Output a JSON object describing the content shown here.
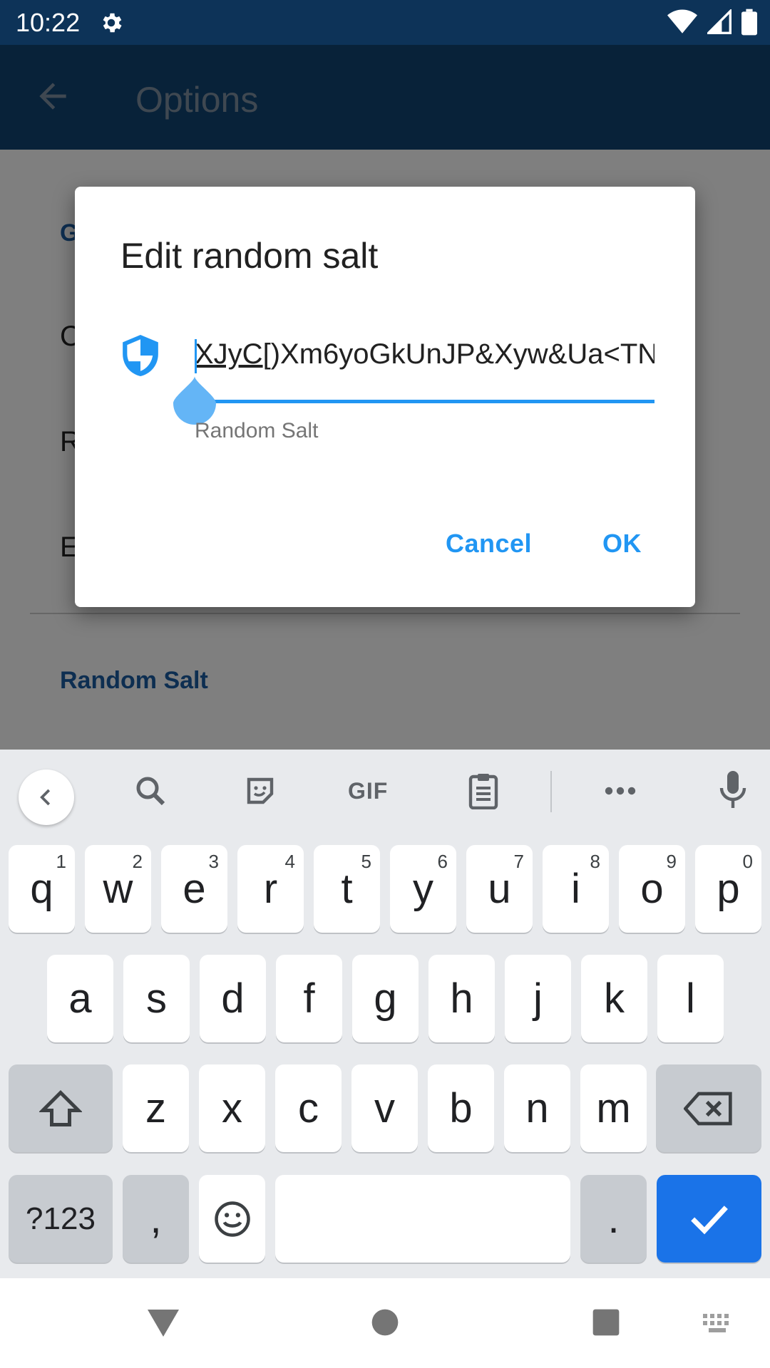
{
  "status_bar": {
    "time": "10:22"
  },
  "app_bar": {
    "title": "Options"
  },
  "settings": {
    "section_1_initial": "G",
    "item_1_initial": "C",
    "item_2_initial": "R",
    "item_3_initial": "E",
    "section_2_header": "Random Salt"
  },
  "dialog": {
    "title": "Edit random salt",
    "input_value_selected": "XJyC",
    "input_value_rest": "[)Xm6yoGkUnJP&Xyw&Ua<TN",
    "helper_label": "Random Salt",
    "cancel_label": "Cancel",
    "ok_label": "OK",
    "accent_color": "#2196f3"
  },
  "keyboard": {
    "toolbar_gif": "GIF",
    "row1": [
      {
        "k": "q",
        "h": "1"
      },
      {
        "k": "w",
        "h": "2"
      },
      {
        "k": "e",
        "h": "3"
      },
      {
        "k": "r",
        "h": "4"
      },
      {
        "k": "t",
        "h": "5"
      },
      {
        "k": "y",
        "h": "6"
      },
      {
        "k": "u",
        "h": "7"
      },
      {
        "k": "i",
        "h": "8"
      },
      {
        "k": "o",
        "h": "9"
      },
      {
        "k": "p",
        "h": "0"
      }
    ],
    "row2": [
      "a",
      "s",
      "d",
      "f",
      "g",
      "h",
      "j",
      "k",
      "l"
    ],
    "row3": [
      "z",
      "x",
      "c",
      "v",
      "b",
      "n",
      "m"
    ],
    "symbols_label": "?123",
    "comma_label": ",",
    "period_label": ".",
    "action_color": "#1a73e8"
  }
}
